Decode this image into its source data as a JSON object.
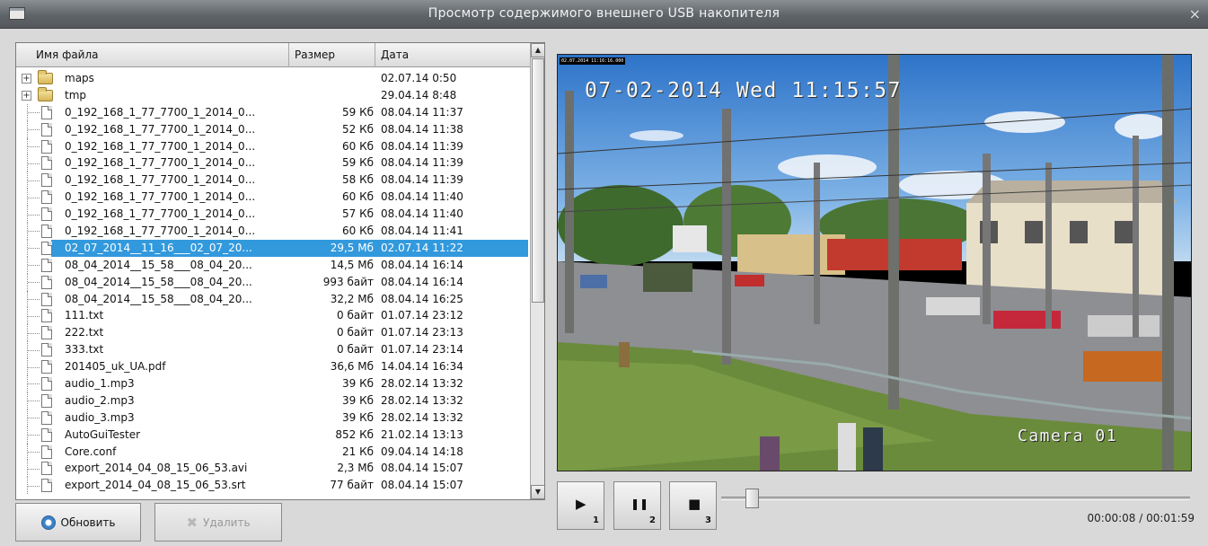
{
  "window": {
    "title": "Просмотр содержимого внешнего USB накопителя",
    "close_glyph": "×",
    "icon": "window-icon"
  },
  "file_list": {
    "headers": [
      "Имя файла",
      "Размер",
      "Дата"
    ],
    "rows": [
      {
        "type": "folder",
        "name": "maps",
        "size": "",
        "date": "02.07.14 0:50",
        "selected": false
      },
      {
        "type": "folder",
        "name": "tmp",
        "size": "",
        "date": "29.04.14 8:48",
        "selected": false
      },
      {
        "type": "file",
        "name": "0_192_168_1_77_7700_1_2014_0...",
        "size": "59 Кб",
        "date": "08.04.14 11:37",
        "selected": false
      },
      {
        "type": "file",
        "name": "0_192_168_1_77_7700_1_2014_0...",
        "size": "52 Кб",
        "date": "08.04.14 11:38",
        "selected": false
      },
      {
        "type": "file",
        "name": "0_192_168_1_77_7700_1_2014_0...",
        "size": "60 Кб",
        "date": "08.04.14 11:39",
        "selected": false
      },
      {
        "type": "file",
        "name": "0_192_168_1_77_7700_1_2014_0...",
        "size": "59 Кб",
        "date": "08.04.14 11:39",
        "selected": false
      },
      {
        "type": "file",
        "name": "0_192_168_1_77_7700_1_2014_0...",
        "size": "58 Кб",
        "date": "08.04.14 11:39",
        "selected": false
      },
      {
        "type": "file",
        "name": "0_192_168_1_77_7700_1_2014_0...",
        "size": "60 Кб",
        "date": "08.04.14 11:40",
        "selected": false
      },
      {
        "type": "file",
        "name": "0_192_168_1_77_7700_1_2014_0...",
        "size": "57 Кб",
        "date": "08.04.14 11:40",
        "selected": false
      },
      {
        "type": "file",
        "name": "0_192_168_1_77_7700_1_2014_0...",
        "size": "60 Кб",
        "date": "08.04.14 11:41",
        "selected": false
      },
      {
        "type": "file",
        "name": "02_07_2014__11_16___02_07_20...",
        "size": "29,5 Мб",
        "date": "02.07.14 11:22",
        "selected": true
      },
      {
        "type": "file",
        "name": "08_04_2014__15_58___08_04_20...",
        "size": "14,5 Мб",
        "date": "08.04.14 16:14",
        "selected": false
      },
      {
        "type": "file",
        "name": "08_04_2014__15_58___08_04_20...",
        "size": "993 байт",
        "date": "08.04.14 16:14",
        "selected": false
      },
      {
        "type": "file",
        "name": "08_04_2014__15_58___08_04_20...",
        "size": "32,2 Мб",
        "date": "08.04.14 16:25",
        "selected": false
      },
      {
        "type": "file",
        "name": "111.txt",
        "size": "0 байт",
        "date": "01.07.14 23:12",
        "selected": false
      },
      {
        "type": "file",
        "name": "222.txt",
        "size": "0 байт",
        "date": "01.07.14 23:13",
        "selected": false
      },
      {
        "type": "file",
        "name": "333.txt",
        "size": "0 байт",
        "date": "01.07.14 23:14",
        "selected": false
      },
      {
        "type": "file",
        "name": "201405_uk_UA.pdf",
        "size": "36,6 Мб",
        "date": "14.04.14 16:34",
        "selected": false
      },
      {
        "type": "file",
        "name": "audio_1.mp3",
        "size": "39 Кб",
        "date": "28.02.14 13:32",
        "selected": false
      },
      {
        "type": "file",
        "name": "audio_2.mp3",
        "size": "39 Кб",
        "date": "28.02.14 13:32",
        "selected": false
      },
      {
        "type": "file",
        "name": "audio_3.mp3",
        "size": "39 Кб",
        "date": "28.02.14 13:32",
        "selected": false
      },
      {
        "type": "file",
        "name": "AutoGuiTester",
        "size": "852 Кб",
        "date": "21.02.14 13:13",
        "selected": false
      },
      {
        "type": "file",
        "name": "Core.conf",
        "size": "21 Кб",
        "date": "09.04.14 14:18",
        "selected": false
      },
      {
        "type": "file",
        "name": "export_2014_04_08_15_06_53.avi",
        "size": "2,3 Мб",
        "date": "08.04.14 15:07",
        "selected": false
      },
      {
        "type": "file",
        "name": "export_2014_04_08_15_06_53.srt",
        "size": "77 байт",
        "date": "08.04.14 15:07",
        "selected": false
      }
    ]
  },
  "buttons": {
    "refresh_label": "Обновить",
    "delete_label": "Удалить",
    "refresh_icon": "refresh-icon",
    "delete_icon": "delete-icon"
  },
  "video": {
    "stamp": "02.07.2014 11:16:16.000",
    "osd_datetime": "07-02-2014 Wed 11:15:57",
    "osd_camera": "Camera 01",
    "scene": "traffic-camera-frame"
  },
  "controls": {
    "play": {
      "icon": "play-icon",
      "glyph": "▶",
      "hotkey": "1"
    },
    "pause": {
      "icon": "pause-icon",
      "glyph": "❚❚",
      "hotkey": "2"
    },
    "stop": {
      "icon": "stop-icon",
      "glyph": "■",
      "hotkey": "3"
    },
    "progress_fraction": 0.066,
    "time": "00:00:08 / 00:01:59"
  },
  "colors": {
    "selection": "#3399dd",
    "titlebar": "#5f6468"
  }
}
